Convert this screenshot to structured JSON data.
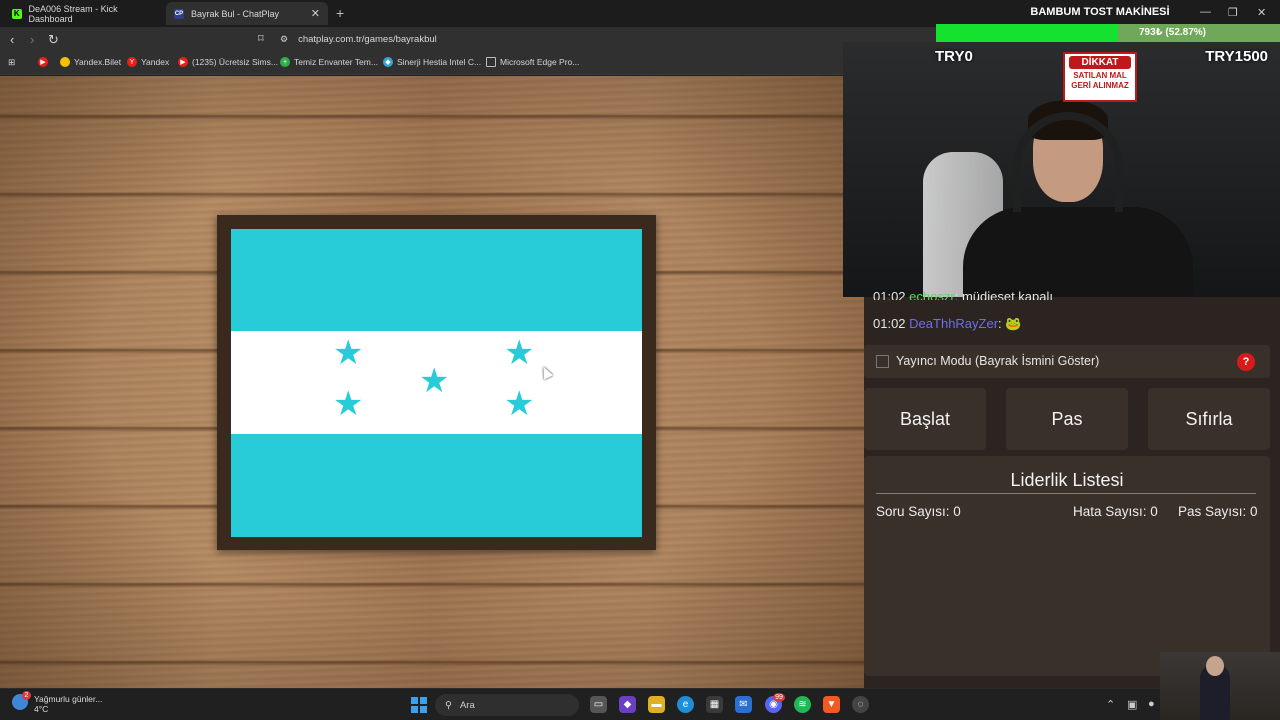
{
  "browser": {
    "tabs": [
      {
        "label": "DeA006 Stream - Kick Dashboard",
        "favicon": "kick-icon"
      },
      {
        "label": "Bayrak Bul - ChatPlay",
        "favicon": "chatplay-icon"
      }
    ],
    "url": "chatplay.com.tr/games/bayrakbul",
    "bookmarks": [
      "Yandex.Bilet",
      "Yandex",
      "(1235) Ücretsiz Sims...",
      "Temiz Envanter Tem...",
      "Sinerji Hestia Intel C...",
      "Microsoft Edge Pro..."
    ]
  },
  "overlay": {
    "product_title": "BAMBUM TOST MAKİNESİ",
    "progress_text": "793₺ (52.87%)",
    "progress_fraction": 0.5287,
    "try_left": "TRY0",
    "try_right": "TRY1500",
    "dikkat_head": "DİKKAT",
    "dikkat_line1": "SATILAN MAL",
    "dikkat_line2": "GERİ ALINMAZ"
  },
  "game": {
    "flag": {
      "stripe_color": "#28ccd8",
      "center_color": "#ffffff",
      "stars": 5
    }
  },
  "chat": {
    "partial": {
      "time": "01:02",
      "user": "echoszr",
      "message": "müdieset kapalı"
    },
    "last": {
      "time": "01:02",
      "user": "DeaThhRayZer",
      "message": "🐸"
    }
  },
  "panel": {
    "streamer_mode_label": "Yayıncı Modu (Bayrak İsmini Göster)",
    "help": "?",
    "buttons": {
      "start": "Başlat",
      "pass": "Pas",
      "reset": "Sıfırla"
    },
    "leaderboard": {
      "title": "Liderlik Listesi",
      "questions": "Soru Sayısı: 0",
      "errors": "Hata Sayısı: 0",
      "passes": "Pas Sayısı: 0"
    }
  },
  "taskbar": {
    "weather_text": "Yağmurlu günler...",
    "weather_temp": "4°C",
    "weather_badge": "2",
    "search_label": "Ara",
    "discord_badge": "99"
  }
}
